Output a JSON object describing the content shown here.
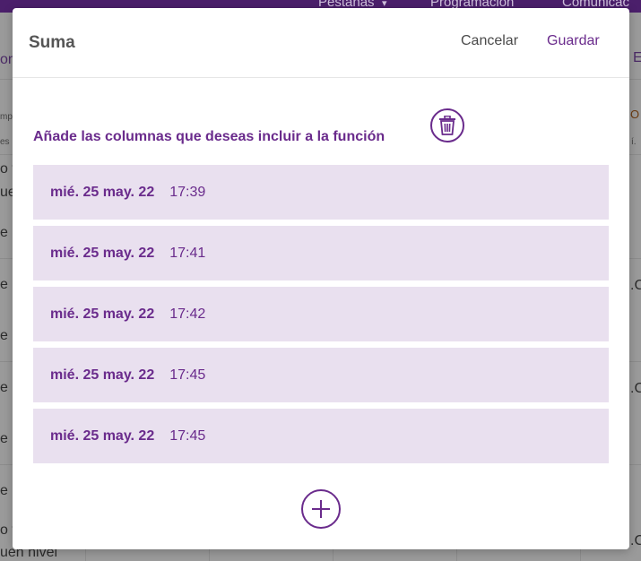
{
  "background": {
    "nav": [
      "Pestañas",
      "Programación",
      "Comunicac"
    ],
    "left_fragments": [
      "om",
      "mp",
      "es",
      "o t",
      "ue",
      "e b",
      "e b",
      "e b",
      "e b",
      "e b",
      "e b",
      "o t",
      "uen nivel"
    ],
    "right_fragments": [
      "E",
      "O",
      "í.",
      ".C",
      ".C",
      ".C"
    ]
  },
  "modal": {
    "title": "Suma",
    "cancel_label": "Cancelar",
    "save_label": "Guardar",
    "section_label": "Añade las columnas que deseas incluir a la función",
    "rows": [
      {
        "date": "mié. 25 may. 22",
        "time": "17:39"
      },
      {
        "date": "mié. 25 may. 22",
        "time": "17:41"
      },
      {
        "date": "mié. 25 may. 22",
        "time": "17:42"
      },
      {
        "date": "mié. 25 may. 22",
        "time": "17:45"
      },
      {
        "date": "mié. 25 may. 22",
        "time": "17:45"
      }
    ]
  },
  "colors": {
    "accent": "#6a2b8c",
    "row_bg": "#e9e0ef",
    "topbar": "#4b1f6b"
  },
  "icons": {
    "delete": "trash-icon",
    "add": "plus-circle-icon",
    "nav_dropdown": "caret-down-icon"
  }
}
